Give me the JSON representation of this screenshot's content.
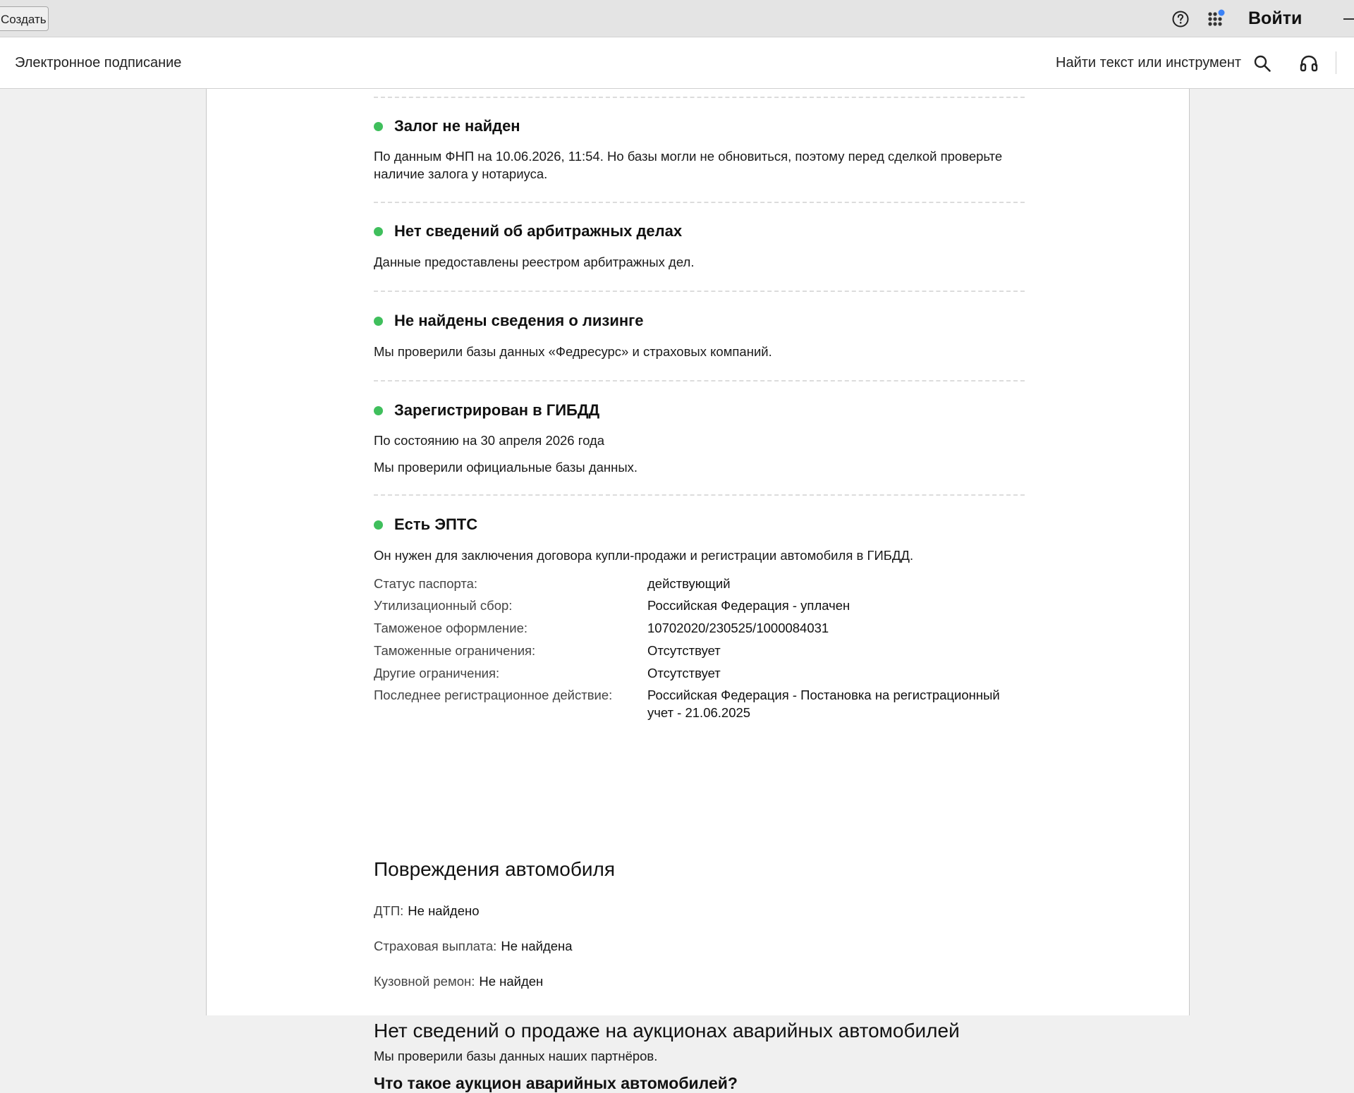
{
  "topbar": {
    "create_label": "Создать",
    "login_label": "Войти",
    "help_icon": "question-circle-icon",
    "apps_icon": "apps-grid-icon"
  },
  "toolbar": {
    "app_name": "Электронное подписание",
    "search_label": "Найти текст или инструмент",
    "search_icon": "search-icon",
    "support_icon": "headset-icon"
  },
  "colors": {
    "status_ok": "#3fbf5c",
    "notification_dot": "#3b82f6"
  },
  "sections": [
    {
      "title": "Залог не найден",
      "lines": [
        "По данным ФНП на 10.06.2026, 11:54. Но базы могли не обновиться, поэтому перед сделкой проверьте наличие залога у нотариуса."
      ]
    },
    {
      "title": "Нет сведений об арбитражных делах",
      "lines": [
        "Данные предоставлены реестром арбитражных дел."
      ]
    },
    {
      "title": "Не найдены сведения о лизинге",
      "lines": [
        "Мы проверили базы данных «Федресурс» и страховых компаний."
      ]
    },
    {
      "title": "Зарегистрирован в ГИБДД",
      "lines": [
        "По состоянию на 30 апреля 2026 года",
        "Мы проверили официальные базы данных."
      ]
    },
    {
      "title": "Есть ЭПТС",
      "lines": [
        "Он нужен для заключения договора купли-продажи и регистрации автомобиля в ГИБДД."
      ]
    }
  ],
  "epts_details": [
    {
      "label": "Статус паспорта:",
      "value": "действующий"
    },
    {
      "label": "Утилизационный сбор:",
      "value": "Российская Федерация - уплачен"
    },
    {
      "label": "Таможеное оформление:",
      "value": "10702020/230525/1000084031"
    },
    {
      "label": "Таможенные ограничения:",
      "value": "Отсутствует"
    },
    {
      "label": "Другие ограничения:",
      "value": "Отсутствует"
    },
    {
      "label": "Последнее регистрационное действие:",
      "value": "Российская Федерация - Постановка на регистрационный учет - 21.06.2025"
    }
  ],
  "damage": {
    "heading": "Повреждения автомобиля",
    "items": [
      {
        "label": "ДТП:",
        "value": "Не найдено"
      },
      {
        "label": "Страховая выплата:",
        "value": "Не найдена"
      },
      {
        "label": "Кузовной ремон:",
        "value": "Не найден"
      }
    ]
  },
  "auction": {
    "heading": "Нет сведений о продаже на аукционах аварийных автомобилей",
    "text": "Мы проверили базы данных наших партнёров.",
    "question": "Что такое аукцион аварийных автомобилей?"
  }
}
